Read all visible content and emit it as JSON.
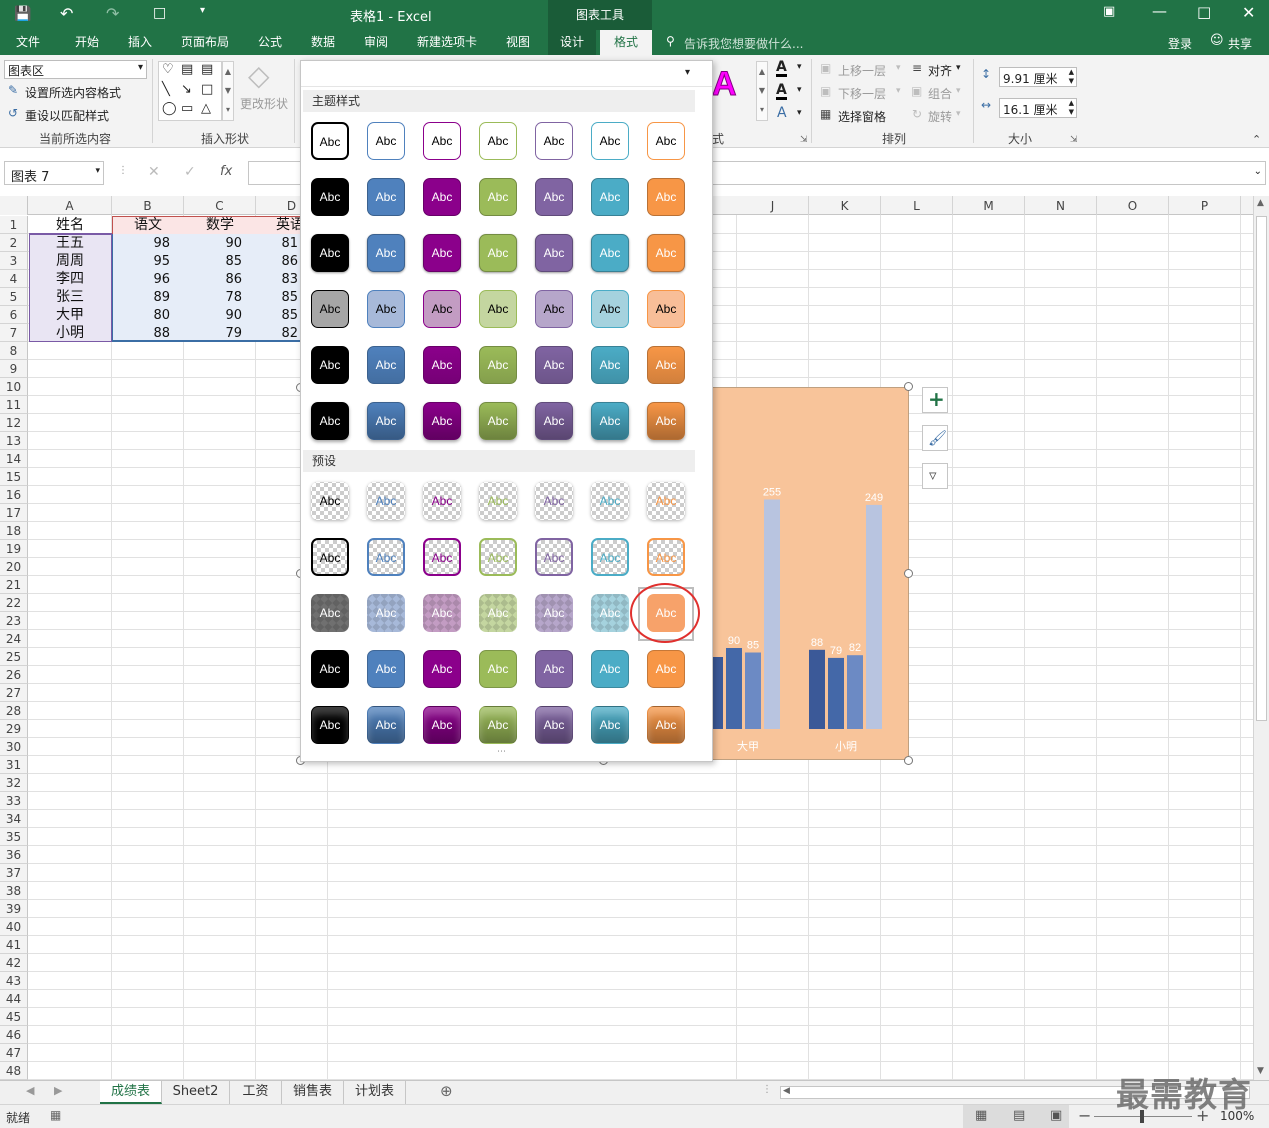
{
  "titlebar": {
    "title": "表格1 - Excel",
    "context_tool": "图表工具"
  },
  "tabs": [
    {
      "label": "文件"
    },
    {
      "label": "开始"
    },
    {
      "label": "插入"
    },
    {
      "label": "页面布局"
    },
    {
      "label": "公式"
    },
    {
      "label": "数据"
    },
    {
      "label": "审阅"
    },
    {
      "label": "新建选项卡"
    },
    {
      "label": "视图"
    },
    {
      "label": "设计"
    },
    {
      "label": "格式"
    }
  ],
  "tell_me": "告诉我您想要做什么...",
  "login": "登录",
  "share": "共享",
  "ribbon": {
    "selection_box": "图表区",
    "format_selection": "设置所选内容格式",
    "reset_style": "重设以匹配样式",
    "group_current": "当前所选内容",
    "change_shape": "更改形状",
    "group_insert_shapes": "插入形状",
    "bring_forward": "上移一层",
    "send_backward": "下移一层",
    "selection_pane": "选择窗格",
    "align": "对齐",
    "group": "组合",
    "rotate": "旋转",
    "group_arrange": "排列",
    "height": "9.91 厘米",
    "width": "16.1 厘米",
    "group_size": "大小",
    "wordart_partial_label": "式"
  },
  "formula_bar": {
    "name_box": "图表 7",
    "fx": "fx"
  },
  "columns": [
    "A",
    "B",
    "C",
    "D",
    "J",
    "K",
    "L",
    "M",
    "N",
    "O",
    "P"
  ],
  "table": {
    "headers": [
      "姓名",
      "语文",
      "数学",
      "英语"
    ],
    "rows": [
      [
        "王五",
        "98",
        "90",
        "81"
      ],
      [
        "周周",
        "95",
        "85",
        "86"
      ],
      [
        "李四",
        "96",
        "86",
        "83"
      ],
      [
        "张三",
        "89",
        "78",
        "85"
      ],
      [
        "大甲",
        "80",
        "90",
        "85"
      ],
      [
        "小明",
        "88",
        "79",
        "82"
      ]
    ]
  },
  "gallery": {
    "theme_section": "主题样式",
    "preset_section": "预设",
    "swatch_label": "Abc",
    "colors": [
      "#000000",
      "#4f81bd",
      "#8b008b",
      "#9bbb59",
      "#8064a2",
      "#4bacc6",
      "#f79646"
    ],
    "light_colors": [
      "#a6a6a6",
      "#a7b9d9",
      "#c39cc3",
      "#c4d6a0",
      "#b6a6ca",
      "#a5d2de",
      "#f8be98"
    ],
    "selected": "预设第3行第7列"
  },
  "chart_data": {
    "type": "bar",
    "categories": [
      "大甲",
      "小明"
    ],
    "series": [
      {
        "values": [
          80,
          88
        ]
      },
      {
        "values": [
          90,
          79
        ]
      },
      {
        "values": [
          85,
          82
        ]
      },
      {
        "values": [
          255,
          249
        ]
      }
    ],
    "data_labels": true,
    "background": "#f8c49a"
  },
  "sheet_tabs": [
    "成绩表",
    "Sheet2",
    "工资",
    "销售表",
    "计划表"
  ],
  "status": {
    "ready": "就绪",
    "zoom": "100%"
  },
  "watermark": "最需教育"
}
